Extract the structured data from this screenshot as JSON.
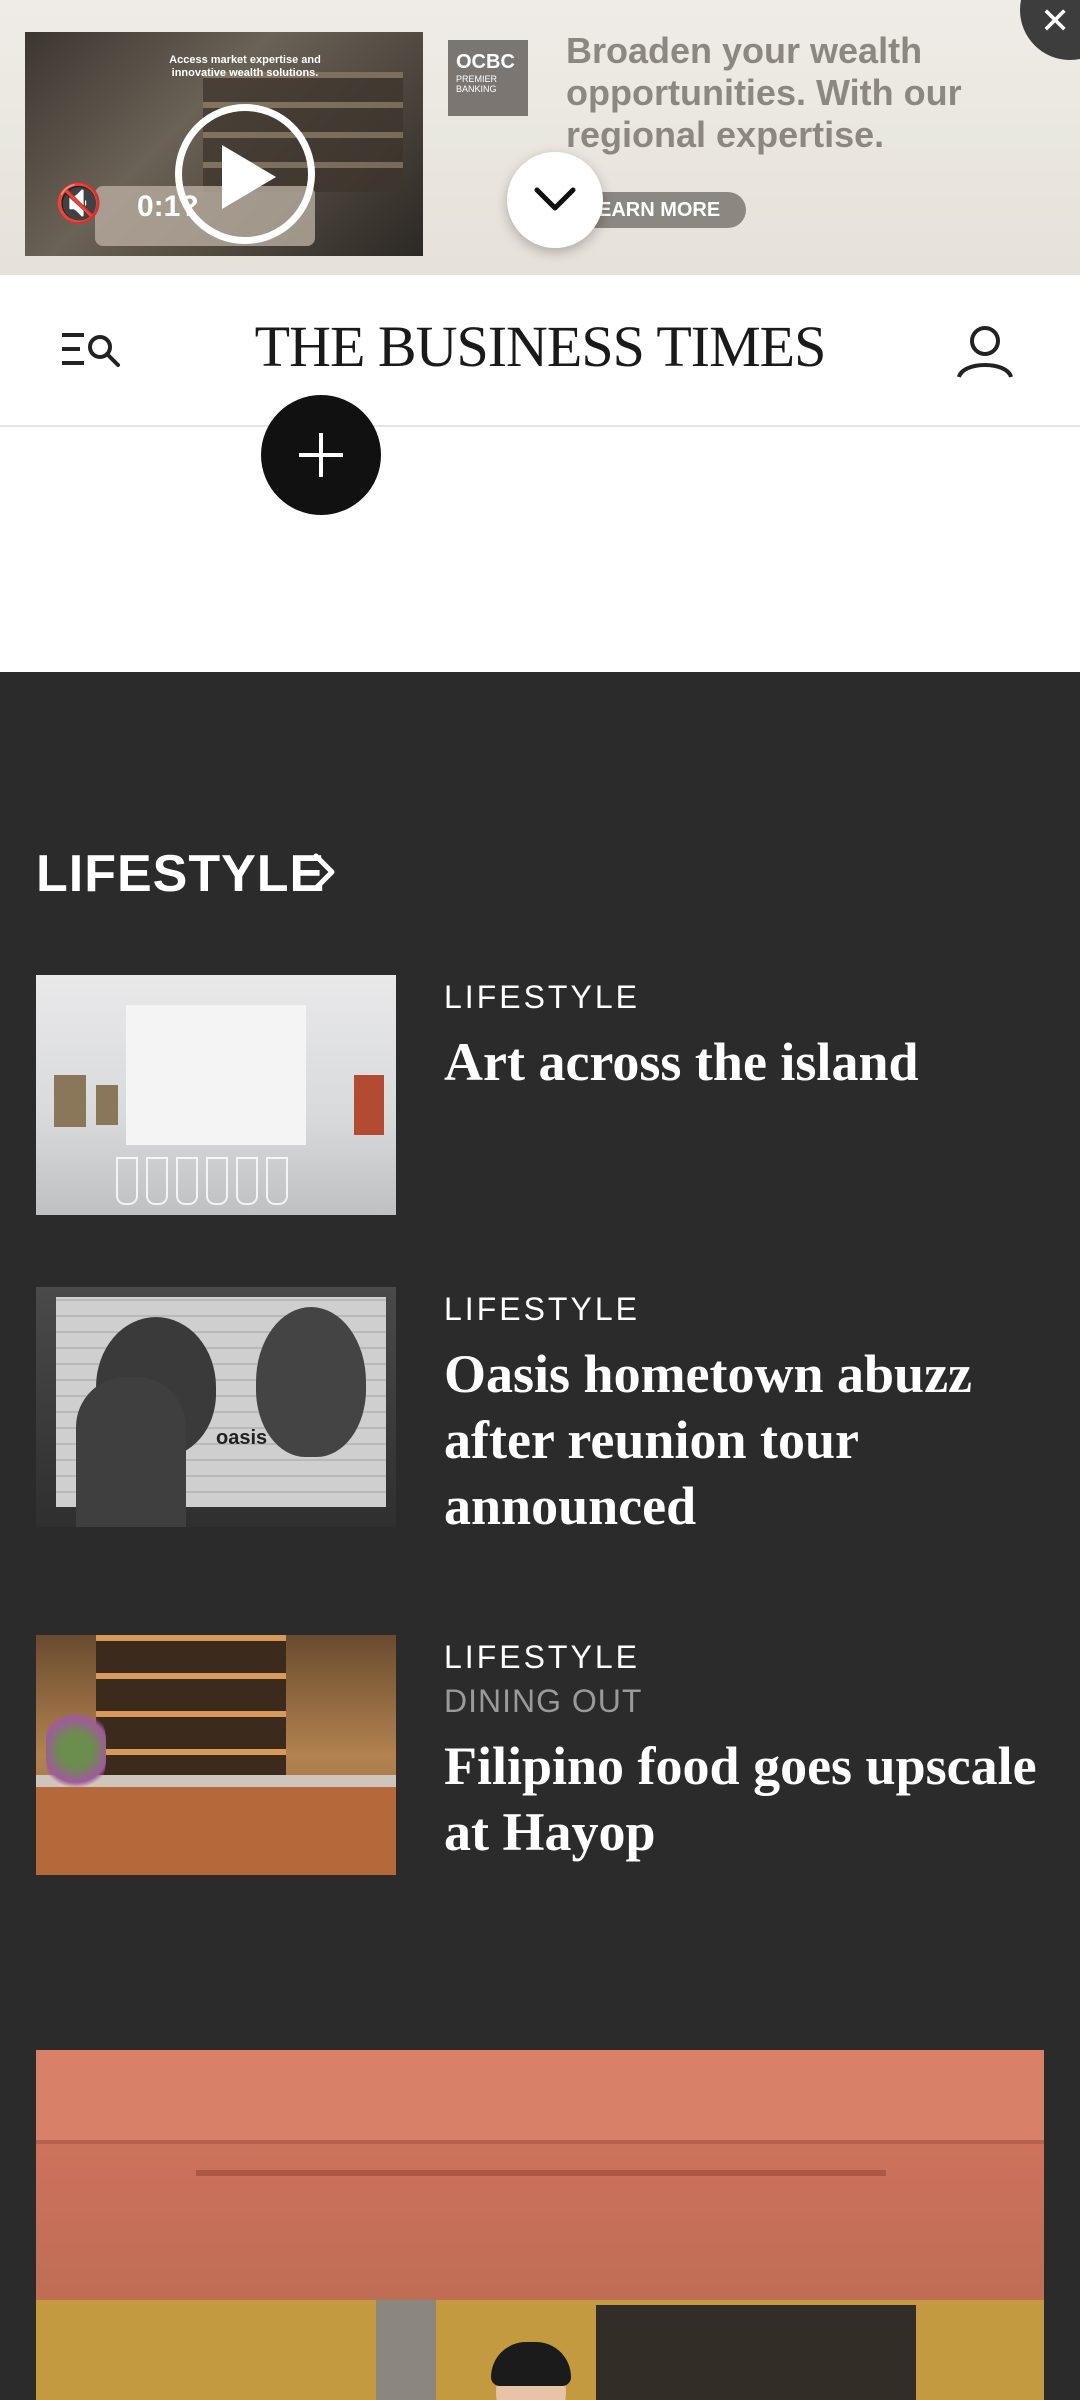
{
  "ad": {
    "video_caption": "Access market expertise and innovative wealth solutions.",
    "video_time": "0:1?",
    "brand_line1": "OCBC",
    "brand_line2": "PREMIER BANKING",
    "headline": "Broaden your wealth opportunities. With our regional expertise.",
    "cta": "LEARN MORE"
  },
  "header": {
    "masthead": "THE BUSINESS TIMES"
  },
  "lifestyle": {
    "section_title": "LIFESTYLE",
    "articles": [
      {
        "category": "LIFESTYLE",
        "subcategory": "",
        "headline": "Art across the island"
      },
      {
        "category": "LIFESTYLE",
        "subcategory": "",
        "headline": "Oasis hometown abuzz after reunion tour announced"
      },
      {
        "category": "LIFESTYLE",
        "subcategory": "DINING OUT",
        "headline": "Filipino food goes upscale at Hayop"
      }
    ]
  },
  "icons": {
    "menu_search": "menu-search-icon",
    "account": "account-icon",
    "plus": "plus-icon",
    "chevron_right": "chevron-right-icon",
    "chevron_down": "chevron-down-icon",
    "close": "close-icon",
    "play": "play-icon",
    "mute": "mute-icon"
  },
  "colors": {
    "section_background": "#2b2b2b",
    "ad_background": "#ebe7e1",
    "ad_text": "#8d8782"
  }
}
